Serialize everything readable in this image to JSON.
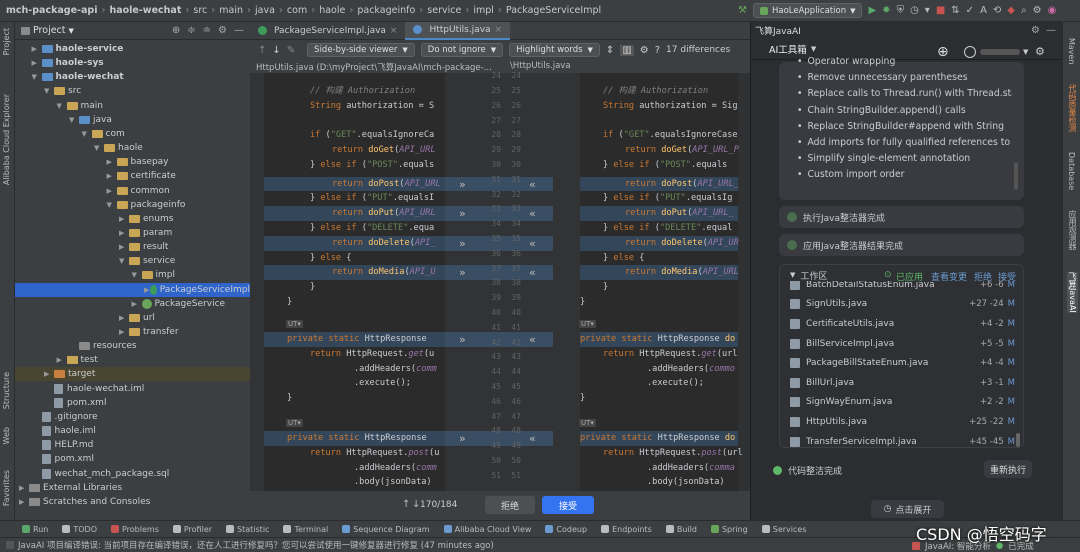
{
  "breadcrumb": [
    "mch-package-api",
    "haole-wechat",
    "src",
    "main",
    "java",
    "com",
    "haole",
    "packageinfo",
    "service",
    "impl",
    "PackageServiceImpl"
  ],
  "run_config": "HaoLeApplication",
  "left_strip": [
    "Project",
    "Alibaba Cloud Explorer",
    "Structure",
    "Web",
    "Favorites"
  ],
  "right_strip": [
    "Maven",
    "代码质量检测",
    "Database",
    "应用观测器",
    "飞算JavaAI"
  ],
  "project": {
    "header": "Project",
    "tree": [
      {
        "label": "haole-service",
        "indent": 1,
        "icon": "blue",
        "bold": true,
        "arrow": "▶"
      },
      {
        "label": "haole-sys",
        "indent": 1,
        "icon": "blue",
        "bold": true,
        "arrow": "▶"
      },
      {
        "label": "haole-wechat",
        "indent": 1,
        "icon": "blue",
        "bold": true,
        "arrow": "▼"
      },
      {
        "label": "src",
        "indent": 2,
        "icon": "folder",
        "arrow": "▼"
      },
      {
        "label": "main",
        "indent": 3,
        "icon": "folder",
        "arrow": "▼"
      },
      {
        "label": "java",
        "indent": 4,
        "icon": "blue",
        "arrow": "▼"
      },
      {
        "label": "com",
        "indent": 5,
        "icon": "folder",
        "arrow": "▼"
      },
      {
        "label": "haole",
        "indent": 6,
        "icon": "folder",
        "arrow": "▼"
      },
      {
        "label": "basepay",
        "indent": 7,
        "icon": "folder",
        "arrow": "▶"
      },
      {
        "label": "certificate",
        "indent": 7,
        "icon": "folder",
        "arrow": "▶"
      },
      {
        "label": "common",
        "indent": 7,
        "icon": "folder",
        "arrow": "▶"
      },
      {
        "label": "packageinfo",
        "indent": 7,
        "icon": "folder",
        "arrow": "▼"
      },
      {
        "label": "enums",
        "indent": 8,
        "icon": "folder",
        "arrow": "▶"
      },
      {
        "label": "param",
        "indent": 8,
        "icon": "folder",
        "arrow": "▶"
      },
      {
        "label": "result",
        "indent": 8,
        "icon": "folder",
        "arrow": "▶"
      },
      {
        "label": "service",
        "indent": 8,
        "icon": "folder",
        "arrow": "▼"
      },
      {
        "label": "impl",
        "indent": 9,
        "icon": "folder",
        "arrow": "▼"
      },
      {
        "label": "PackageServiceImpl",
        "indent": 10,
        "icon": "class",
        "arrow": "▶",
        "selected": true
      },
      {
        "label": "PackageService",
        "indent": 9,
        "icon": "iface",
        "arrow": "▶"
      },
      {
        "label": "url",
        "indent": 8,
        "icon": "folder",
        "arrow": "▶"
      },
      {
        "label": "transfer",
        "indent": 8,
        "icon": "folder",
        "arrow": "▶"
      },
      {
        "label": "resources",
        "indent": 4,
        "icon": "grey",
        "arrow": ""
      },
      {
        "label": "test",
        "indent": 3,
        "icon": "folder",
        "arrow": "▶"
      },
      {
        "label": "target",
        "indent": 2,
        "icon": "orange",
        "arrow": "▶",
        "target": true
      },
      {
        "label": "haole-wechat.iml",
        "indent": 2,
        "icon": "file",
        "arrow": ""
      },
      {
        "label": "pom.xml",
        "indent": 2,
        "icon": "file",
        "arrow": ""
      },
      {
        "label": ".gitignore",
        "indent": 1,
        "icon": "file",
        "arrow": ""
      },
      {
        "label": "haole.iml",
        "indent": 1,
        "icon": "file",
        "arrow": ""
      },
      {
        "label": "HELP.md",
        "indent": 1,
        "icon": "file",
        "arrow": ""
      },
      {
        "label": "pom.xml",
        "indent": 1,
        "icon": "file",
        "arrow": ""
      },
      {
        "label": "wechat_mch_package.sql",
        "indent": 1,
        "icon": "file",
        "arrow": ""
      },
      {
        "label": "External Libraries",
        "indent": 0,
        "icon": "grey",
        "arrow": "▶"
      },
      {
        "label": "Scratches and Consoles",
        "indent": 0,
        "icon": "grey",
        "arrow": "▶"
      }
    ]
  },
  "editor": {
    "tabs": [
      "PackageServiceImpl.java",
      "HttpUtils.java"
    ],
    "viewer": "Side-by-side viewer",
    "ignore": "Do not ignore",
    "highlight": "Highlight words",
    "differences": "17 differences",
    "left_path": "HttpUtils.java (D:\\myProject\\飞算JavaAI\\mch-package-...",
    "right_path": "\\HttpUtils.java",
    "left_line_numbers": [
      "24",
      "25",
      "26",
      "27",
      "28",
      "29",
      "30",
      "31",
      "32",
      "33",
      "34",
      "35",
      "36",
      "37",
      "38",
      "39",
      "40",
      "41",
      "42",
      "43",
      "44",
      "45",
      "46",
      "47",
      "48",
      "49",
      "50",
      "51"
    ],
    "right_line_numbers": [
      "24",
      "25",
      "26",
      "27",
      "28",
      "29",
      "30",
      "31",
      "32",
      "33",
      "34",
      "35",
      "36",
      "37",
      "38",
      "39",
      "40",
      "41",
      "42",
      "43",
      "44",
      "45",
      "46",
      "47",
      "48",
      "49",
      "50",
      "51"
    ],
    "counter": "170/184",
    "reject": "拒绝",
    "accept": "接受"
  },
  "ai": {
    "title": "飞算JavaAI",
    "tab": "AI工具箱",
    "fixes": [
      "Operator wrapping",
      "Remove unnecessary parentheses",
      "Replace calls to Thread.run() with Thread.start",
      "Chain StringBuilder.append() calls",
      "Replace StringBuilder#append with String",
      "Add imports for fully qualified references to ty",
      "Simplify single-element annotation",
      "Custom import order"
    ],
    "step1": "执行Java整洁器完成",
    "step2": "应用Java整洁器结果完成",
    "workspace": {
      "title": "工作区",
      "applied": "已应用",
      "view": "查看变更",
      "reject": "拒绝",
      "accept": "接受",
      "files": [
        {
          "name": "BatchDetailStatusEnum.java",
          "diff": "+6 -6",
          "m": "M"
        },
        {
          "name": "SignUtils.java",
          "diff": "+27 -24",
          "m": "M"
        },
        {
          "name": "CertificateUtils.java",
          "diff": "+4 -2",
          "m": "M"
        },
        {
          "name": "BillServiceImpl.java",
          "diff": "+5 -5",
          "m": "M"
        },
        {
          "name": "PackageBillStateEnum.java",
          "diff": "+4 -4",
          "m": "M"
        },
        {
          "name": "BillUrl.java",
          "diff": "+3 -1",
          "m": "M"
        },
        {
          "name": "SignWayEnum.java",
          "diff": "+2 -2",
          "m": "M"
        },
        {
          "name": "HttpUtils.java",
          "diff": "+25 -22",
          "m": "M"
        },
        {
          "name": "TransferServiceImpl.java",
          "diff": "+45 -45",
          "m": "M"
        }
      ]
    },
    "done": "代码整洁完成",
    "rerun": "重新执行",
    "expand": "点击展开"
  },
  "bottom_tools": [
    "Run",
    "TODO",
    "Problems",
    "Profiler",
    "Statistic",
    "Terminal",
    "Sequence Diagram",
    "Alibaba Cloud View",
    "Codeup",
    "Endpoints",
    "Build",
    "Spring",
    "Services"
  ],
  "status": {
    "message": "JavaAI 项目编译错误: 当前项目存在编译错误，还在人工进行修复吗？您可以尝试使用一键修复器进行修复 (47 minutes ago)",
    "right1": "JavaAI: 智能分析",
    "right2": "已完成"
  },
  "watermark": "CSDN @悟空码字"
}
